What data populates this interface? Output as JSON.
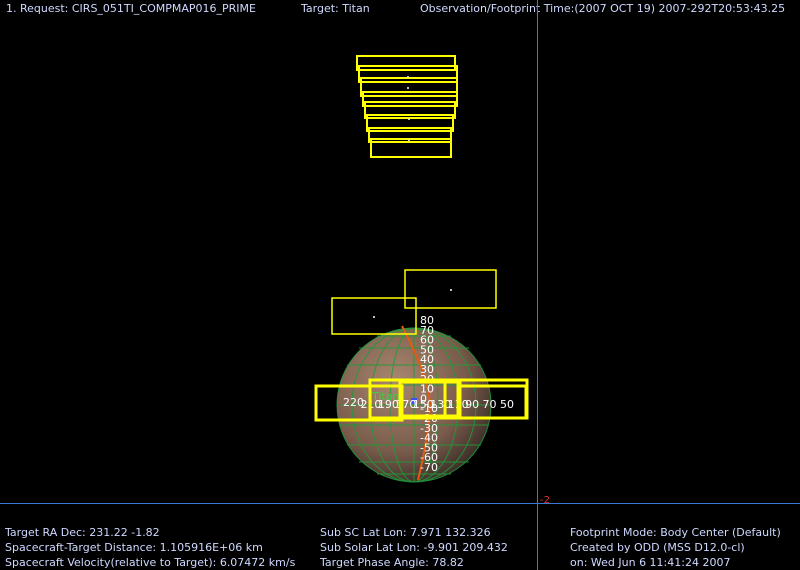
{
  "header": {
    "request": "1. Request: CIRS_051TI_COMPMAP016_PRIME",
    "target": "Target: Titan",
    "obs_time": "Observation/Footprint Time:(2007 OCT 19) 2007-292T20:53:43.25"
  },
  "plot": {
    "target_label": "Titan",
    "axis_marker": "-2",
    "lat_ticks": [
      "80",
      "70",
      "60",
      "50",
      "40",
      "30",
      "20",
      "10",
      "0",
      "-10",
      "-20",
      "-30",
      "-40",
      "-50",
      "-60",
      "-70"
    ],
    "lon_labels": [
      "220",
      "210",
      "190",
      "170",
      "150",
      "130",
      "110",
      "90",
      "70",
      "50"
    ],
    "colors": {
      "footprint": "#ffff00",
      "grid": "#1f9a3a",
      "terminator": "#e35a10",
      "axis": "#3a7ad4",
      "sphere": "#8a6a55"
    }
  },
  "info_left": {
    "ra_dec": "Target RA  Dec: 231.22   -1.82",
    "distance": "Spacecraft-Target Distance: 1.105916E+06 km",
    "velocity": "Spacecraft Velocity(relative to Target): 6.07472 km/s"
  },
  "info_mid": {
    "sub_sc": "Sub SC Lat Lon:  7.971   132.326",
    "sub_solar": "Sub Solar Lat Lon: -9.901   209.432",
    "phase": "Target Phase Angle: 78.82"
  },
  "info_right": {
    "mode": "Footprint Mode: Body Center (Default)",
    "created": "Created by ODD (MSS D12.0-cl)",
    "date": "on: Wed Jun  6 11:41:24 2007"
  }
}
